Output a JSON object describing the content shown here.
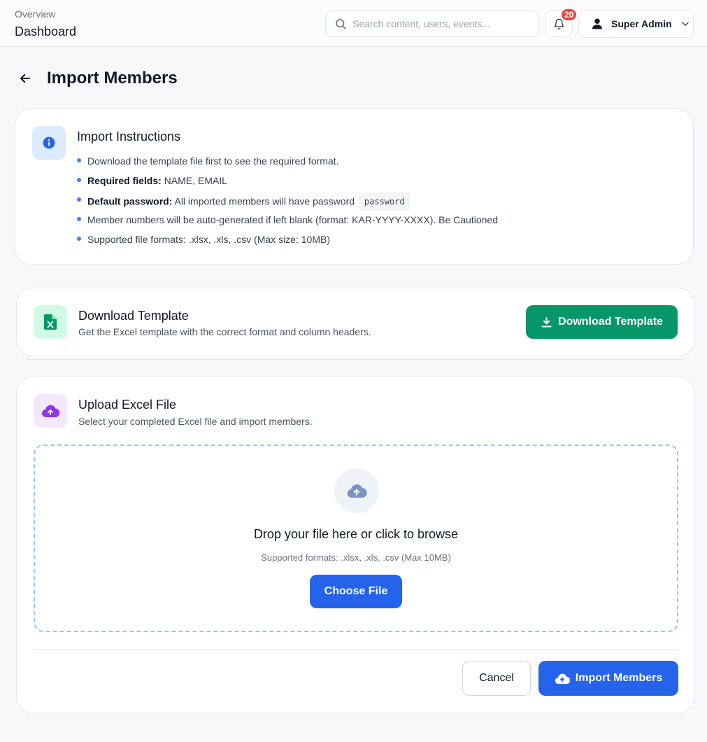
{
  "header": {
    "breadcrumb_parent": "Overview",
    "breadcrumb_current": "Dashboard",
    "search_placeholder": "Search content, users, events...",
    "notification_count": "20",
    "user_name": "Super Admin"
  },
  "page": {
    "title": "Import Members"
  },
  "instructions": {
    "title": "Import Instructions",
    "items": {
      "item1": "Download the template file first to see the required format.",
      "required_label": "Required fields:",
      "required_value": " NAME, EMAIL",
      "default_label": "Default password:",
      "default_value": " All imported members will have password ",
      "default_code": "password",
      "item4": "Member numbers will be auto-generated if left blank (format: KAR-YYYY-XXXX). Be Cautioned",
      "item5": "Supported file formats: .xlsx, .xls, .csv (Max size: 10MB)"
    }
  },
  "download": {
    "title": "Download Template",
    "subtitle": "Get the Excel template with the correct format and column headers.",
    "button_label": "Download Template"
  },
  "upload": {
    "title": "Upload Excel File",
    "subtitle": "Select your completed Excel file and import members.",
    "drop_title": "Drop your file here or click to browse",
    "drop_sub": "Supported formats: .xlsx, .xls, .csv (Max 10MB)",
    "choose_label": "Choose File",
    "cancel_label": "Cancel",
    "import_label": "Import Members"
  },
  "colors": {
    "primary": "#2563eb",
    "success": "#059669",
    "badge": "#ef4444"
  }
}
